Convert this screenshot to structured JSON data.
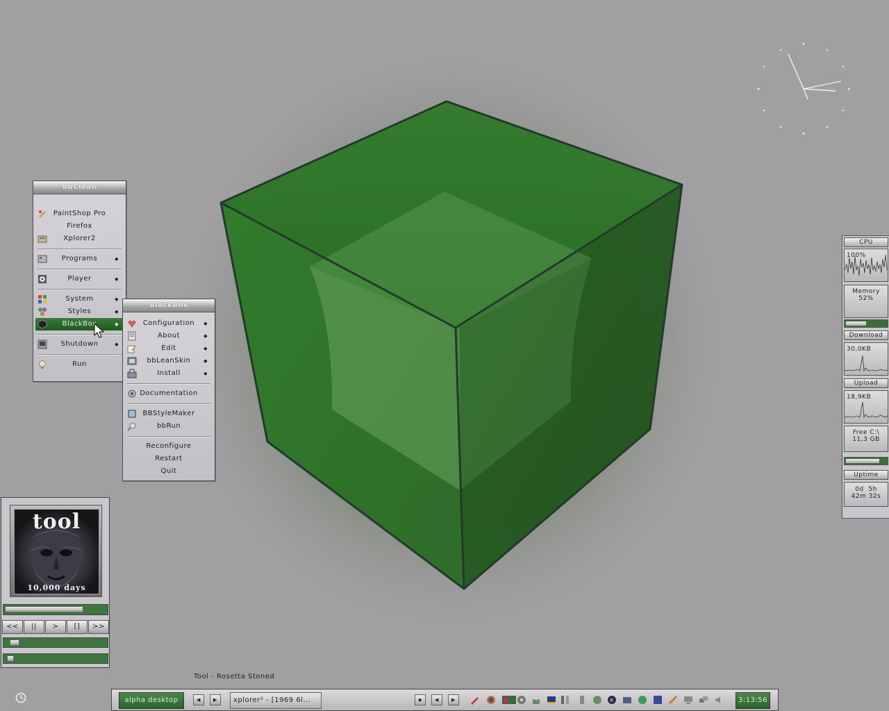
{
  "bbclean_menu": {
    "title": "bbClean",
    "items": [
      {
        "label": "PaintShop Pro",
        "icon": "paintshop-icon",
        "submenu": false
      },
      {
        "label": "Firefox",
        "icon": "",
        "submenu": false
      },
      {
        "label": "Xplorer2",
        "icon": "xplorer-icon",
        "submenu": false
      },
      {
        "label": "Programs",
        "icon": "programs-icon",
        "submenu": true
      },
      {
        "label": "Player",
        "icon": "player-icon",
        "submenu": true
      },
      {
        "label": "System",
        "icon": "system-icon",
        "submenu": true
      },
      {
        "label": "Styles",
        "icon": "styles-icon",
        "submenu": true
      },
      {
        "label": "BlackBox",
        "icon": "blackbox-icon",
        "submenu": true,
        "active": true
      },
      {
        "label": "Shutdown",
        "icon": "shutdown-icon",
        "submenu": true
      },
      {
        "label": "Run",
        "icon": "run-icon",
        "submenu": false
      }
    ]
  },
  "blackbox_menu": {
    "title": "BlackBox",
    "items": [
      {
        "label": "Configuration",
        "icon": "configuration-icon",
        "submenu": true
      },
      {
        "label": "About",
        "icon": "about-icon",
        "submenu": true
      },
      {
        "label": "Edit",
        "icon": "edit-icon",
        "submenu": true
      },
      {
        "label": "bbLeanSkin",
        "icon": "bbleanskin-icon",
        "submenu": true
      },
      {
        "label": "Install",
        "icon": "install-icon",
        "submenu": true
      },
      {
        "label": "Documentation",
        "icon": "documentation-icon",
        "submenu": false
      },
      {
        "label": "BBStyleMaker",
        "icon": "bbstylemaker-icon",
        "submenu": false
      },
      {
        "label": "bbRun",
        "icon": "bbrun-icon",
        "submenu": false
      },
      {
        "label": "Reconfigure",
        "icon": "",
        "submenu": false
      },
      {
        "label": "Restart",
        "icon": "",
        "submenu": false
      },
      {
        "label": "Quit",
        "icon": "",
        "submenu": false
      }
    ]
  },
  "sysmon": {
    "cpu_label": "CPU",
    "cpu_value": "100%",
    "memory_label": "Memory",
    "memory_value": "52%",
    "memory_fraction": 0.52,
    "download_label": "Download",
    "download_value": "30,0KB",
    "upload_label": "Upload",
    "upload_value": "18,9KB",
    "disk_label": "Free C:\\",
    "disk_value": "11,3 GB",
    "disk_fraction": 0.85,
    "uptime_label": "Uptime",
    "uptime_line1": "0d  5h",
    "uptime_line2": "42m 32s"
  },
  "player": {
    "album_artist": "tool",
    "album_title": "10,000 days",
    "progress_fraction": 0.78,
    "buttons": [
      "<<",
      "||",
      ">",
      "[]",
      ">>"
    ],
    "volume_fraction": 0.05,
    "balance_fraction": 0.02
  },
  "now_playing": "Tool - Rosetta Stoned",
  "taskbar": {
    "workspace": "alpha desktop",
    "task": "xplorer² - [1969 6l...",
    "clock": "3:13:56"
  },
  "colors": {
    "desktop": "#a29fa3",
    "accent_green": "#2f6e2f",
    "cube_green": "#2f8a2a"
  }
}
